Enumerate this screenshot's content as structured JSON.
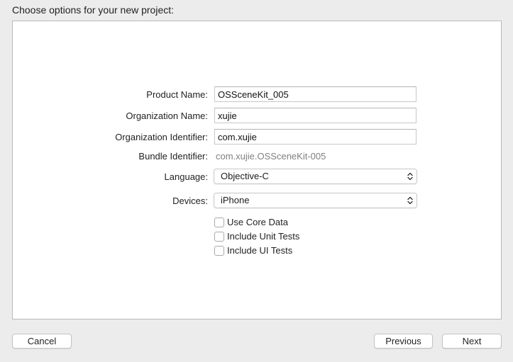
{
  "header": {
    "title": "Choose options for your new project:"
  },
  "form": {
    "product_name": {
      "label": "Product Name:",
      "value": "OSSceneKit_005"
    },
    "organization_name": {
      "label": "Organization Name:",
      "value": "xujie"
    },
    "organization_identifier": {
      "label": "Organization Identifier:",
      "value": "com.xujie"
    },
    "bundle_identifier": {
      "label": "Bundle Identifier:",
      "value": "com.xujie.OSSceneKit-005"
    },
    "language": {
      "label": "Language:",
      "selected": "Objective-C",
      "icon": "chevron-up-down-icon"
    },
    "devices": {
      "label": "Devices:",
      "selected": "iPhone",
      "icon": "chevron-up-down-icon"
    },
    "options": [
      {
        "label": "Use Core Data",
        "checked": false
      },
      {
        "label": "Include Unit Tests",
        "checked": false
      },
      {
        "label": "Include UI Tests",
        "checked": false
      }
    ]
  },
  "footer": {
    "cancel_label": "Cancel",
    "previous_label": "Previous",
    "next_label": "Next"
  },
  "colors": {
    "window_bg": "#ececec",
    "panel_bg": "#ffffff",
    "secondary_text": "#808080"
  }
}
